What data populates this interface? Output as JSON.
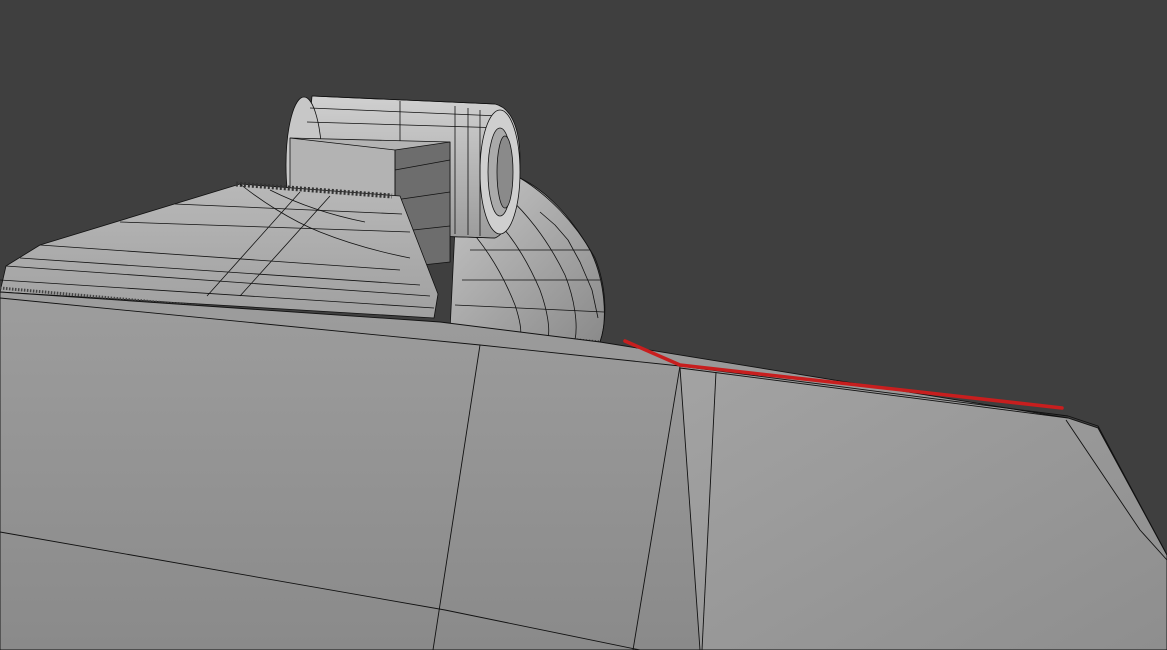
{
  "viewport": {
    "background_color": "#3f3f3f",
    "mesh_face_color": "#8f8f8f",
    "mesh_face_light_color": "#c4c4c4",
    "wireframe_color": "#000000",
    "annotation_color": "#c81e1e"
  }
}
